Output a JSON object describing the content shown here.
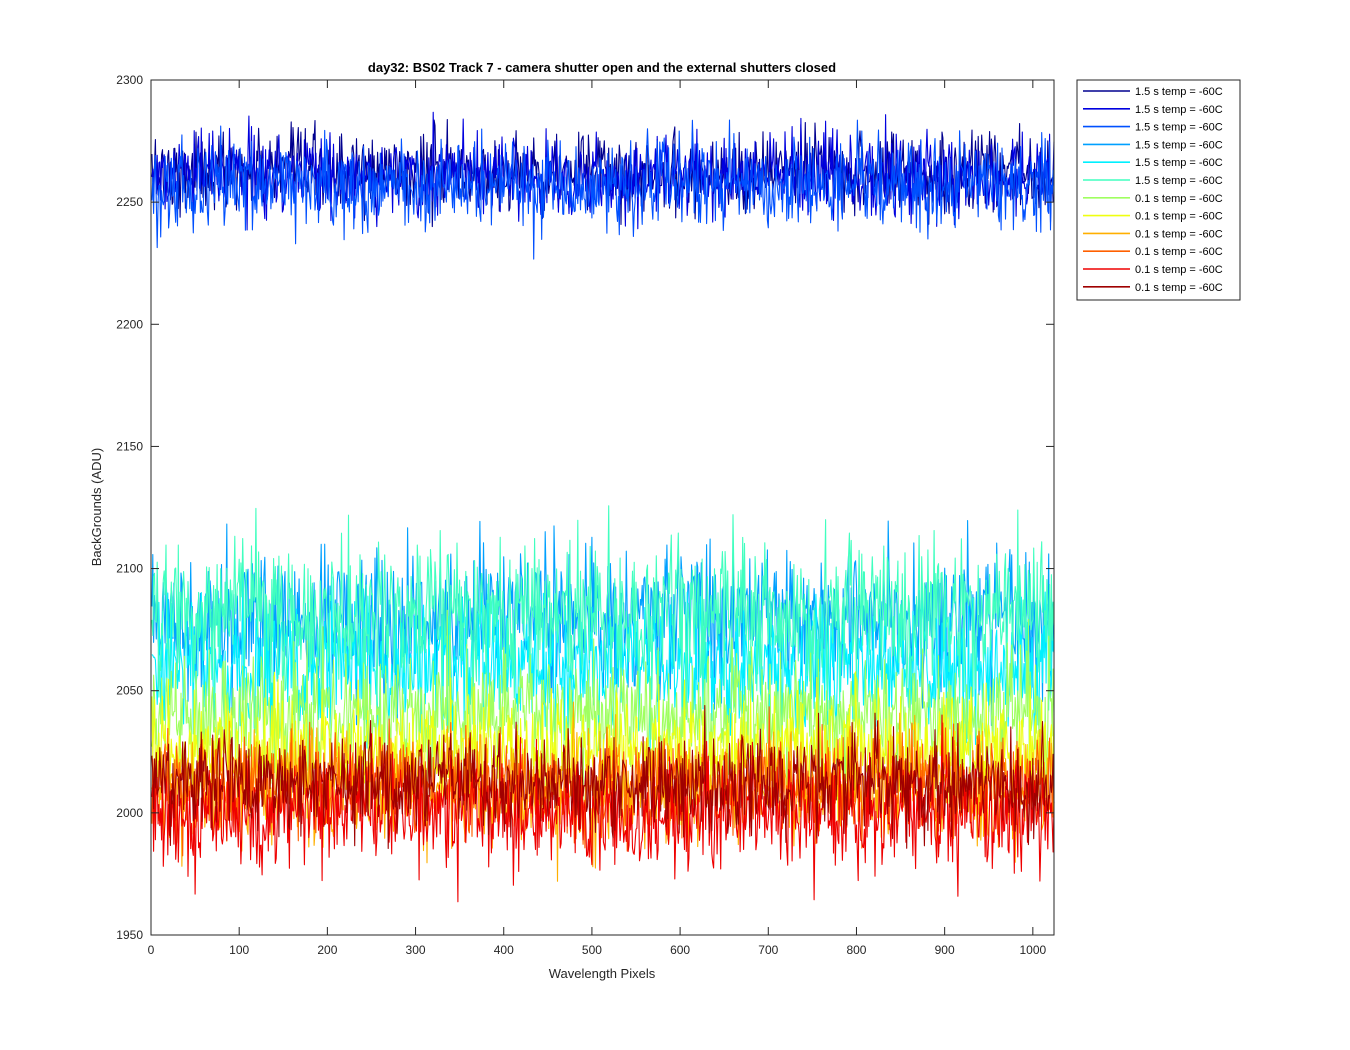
{
  "chart_data": {
    "type": "line",
    "title": "day32: BS02  Track 7 - camera shutter open and the external shutters closed",
    "xlabel": "Wavelength Pixels",
    "ylabel": "BackGrounds (ADU)",
    "xlim": [
      0,
      1024
    ],
    "ylim": [
      1950,
      2300
    ],
    "xticks": [
      0,
      100,
      200,
      300,
      400,
      500,
      600,
      700,
      800,
      900,
      1000
    ],
    "yticks": [
      1950,
      2000,
      2050,
      2100,
      2150,
      2200,
      2250,
      2300
    ],
    "grid": false,
    "legend_position": "outside-top-right",
    "x_range": [
      1,
      1024
    ],
    "series": [
      {
        "name": "1.5 s temp = -60C",
        "color": "#00008f",
        "mean": 2262,
        "noise": 8,
        "min": 2240,
        "max": 2288
      },
      {
        "name": "1.5 s temp = -60C",
        "color": "#0000df",
        "mean": 2261,
        "noise": 8,
        "min": 2238,
        "max": 2287
      },
      {
        "name": "1.5 s temp = -60C",
        "color": "#0050ff",
        "mean": 2257,
        "noise": 9,
        "min": 2225,
        "max": 2285
      },
      {
        "name": "1.5 s temp = -60C",
        "color": "#00a0ff",
        "mean": 2080,
        "noise": 15,
        "min": 2030,
        "max": 2135
      },
      {
        "name": "1.5 s temp = -60C",
        "color": "#00f0ff",
        "mean": 2060,
        "noise": 14,
        "min": 2025,
        "max": 2115
      },
      {
        "name": "1.5 s temp = -60C",
        "color": "#40ffbf",
        "mean": 2082,
        "noise": 15,
        "min": 2035,
        "max": 2145
      },
      {
        "name": "0.1 s temp = -60C",
        "color": "#9fff60",
        "mean": 2040,
        "noise": 12,
        "min": 2005,
        "max": 2085
      },
      {
        "name": "0.1 s temp = -60C",
        "color": "#efff10",
        "mean": 2025,
        "noise": 11,
        "min": 1995,
        "max": 2065
      },
      {
        "name": "0.1 s temp = -60C",
        "color": "#ffaf00",
        "mean": 2010,
        "noise": 11,
        "min": 1967,
        "max": 2050
      },
      {
        "name": "0.1 s temp = -60C",
        "color": "#ff6000",
        "mean": 2012,
        "noise": 10,
        "min": 1980,
        "max": 2050
      },
      {
        "name": "0.1 s temp = -60C",
        "color": "#ef0000",
        "mean": 2000,
        "noise": 11,
        "min": 1963,
        "max": 2045
      },
      {
        "name": "0.1 s temp = -60C",
        "color": "#9f0000",
        "mean": 2012,
        "noise": 10,
        "min": 1985,
        "max": 2048
      }
    ]
  }
}
